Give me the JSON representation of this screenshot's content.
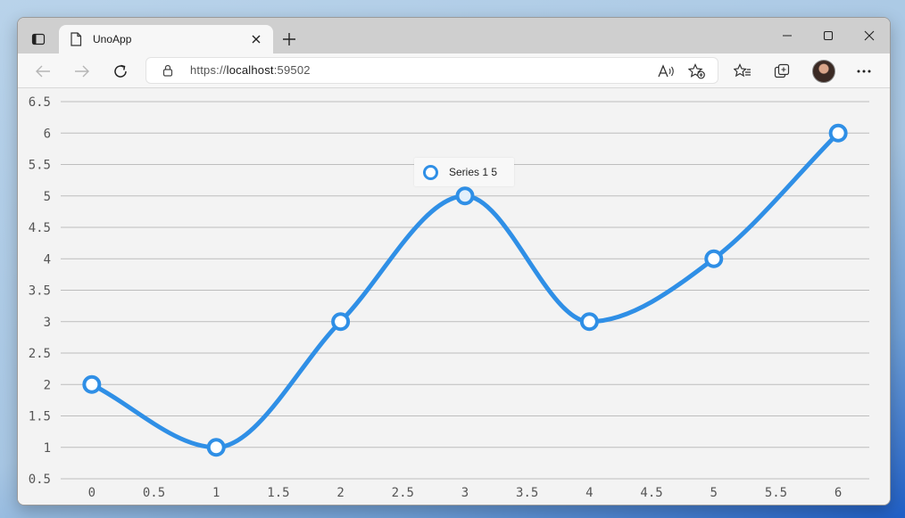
{
  "browser": {
    "tab_title": "UnoApp",
    "url_prefix": "https://",
    "url_host": "localhost",
    "url_port": ":59502"
  },
  "tooltip": {
    "label": "Series 1 5"
  },
  "colors": {
    "series": "#2f8fe6",
    "grid": "#bdbdbd",
    "background": "#f3f3f3"
  },
  "chart_data": {
    "type": "line",
    "title": "",
    "xlabel": "",
    "ylabel": "",
    "xlim": [
      -0.25,
      6.25
    ],
    "ylim": [
      0.5,
      6.5
    ],
    "x_ticks": [
      "0",
      "0.5",
      "1",
      "1.5",
      "2",
      "2.5",
      "3",
      "3.5",
      "4",
      "4.5",
      "5",
      "5.5",
      "6"
    ],
    "y_ticks": [
      "0.5",
      "1",
      "1.5",
      "2",
      "2.5",
      "3",
      "3.5",
      "4",
      "4.5",
      "5",
      "5.5",
      "6",
      "6.5"
    ],
    "grid": true,
    "smooth": true,
    "series": [
      {
        "name": "Series 1",
        "x": [
          0,
          1,
          2,
          3,
          4,
          5,
          6
        ],
        "values": [
          2,
          1,
          3,
          5,
          3,
          4,
          6
        ]
      }
    ],
    "highlighted_point": {
      "series": "Series 1",
      "x": 3,
      "y": 5
    }
  }
}
